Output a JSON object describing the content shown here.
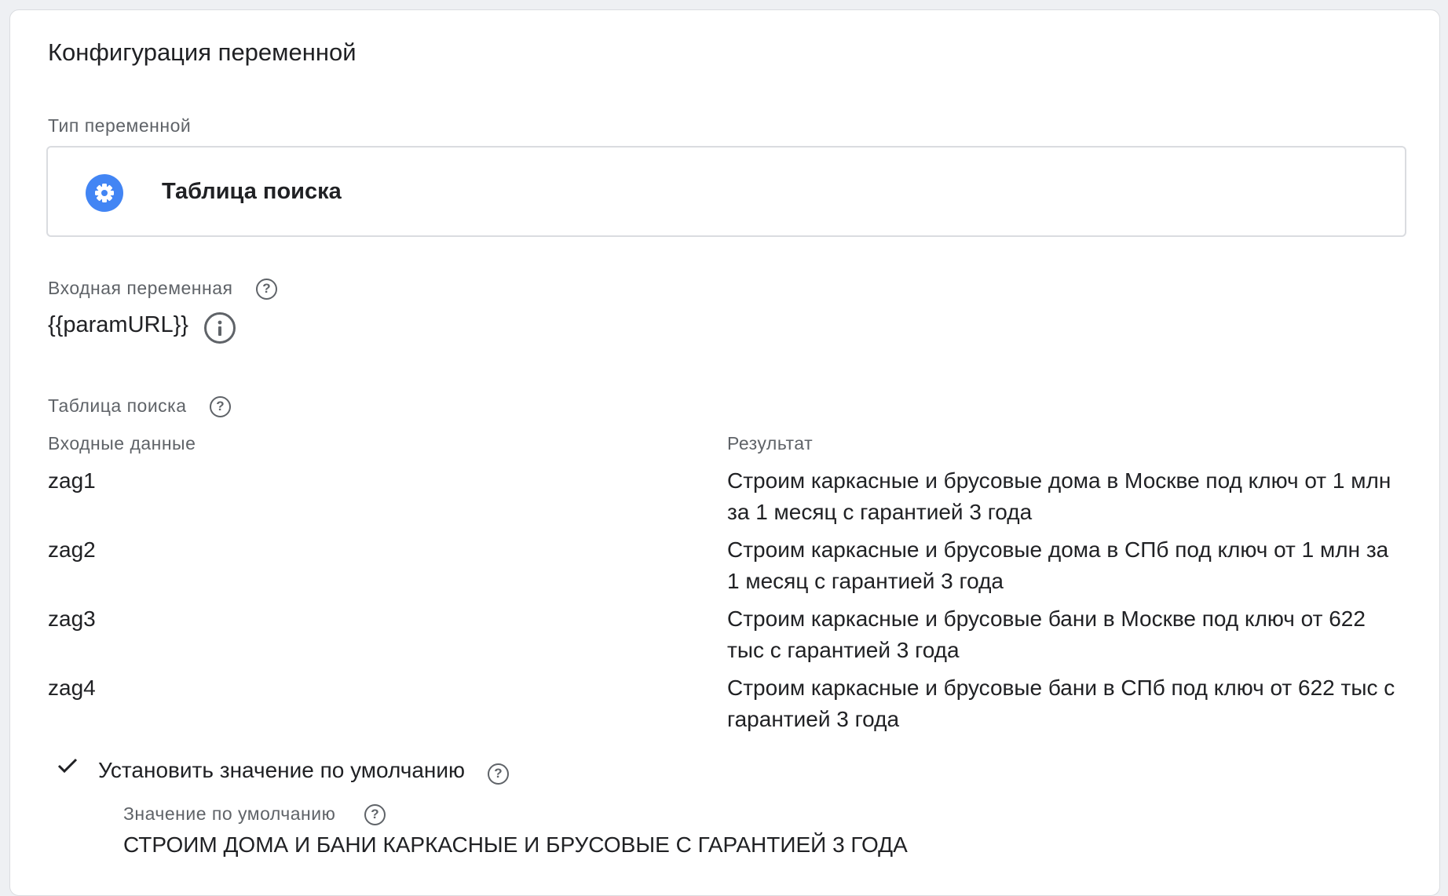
{
  "section": {
    "title": "Конфигурация переменной"
  },
  "variable_type": {
    "label": "Тип переменной",
    "value": "Таблица поиска",
    "icon": "gear-icon",
    "icon_color": "#4285f4"
  },
  "input_variable": {
    "label": "Входная переменная",
    "help_icon": "help-icon",
    "value": "{{paramURL}}",
    "info_icon": "info-icon"
  },
  "lookup_table": {
    "label": "Таблица поиска",
    "help_icon": "help-icon",
    "columns": {
      "input": "Входные данные",
      "output": "Результат"
    },
    "rows": [
      {
        "input": "zag1",
        "output": "Строим каркасные и брусовые дома в Москве под ключ от 1 млн за 1 месяц с гарантией 3 года"
      },
      {
        "input": "zag2",
        "output": "Строим каркасные и брусовые дома в СПб под ключ от 1 млн за 1 месяц с гарантией 3 года"
      },
      {
        "input": "zag3",
        "output": "Строим каркасные и брусовые бани в Москве под ключ от 622 тыс с гарантией 3 года"
      },
      {
        "input": "zag4",
        "output": "Строим каркасные и брусовые бани в СПб под ключ от 622 тыс с гарантией 3 года"
      }
    ]
  },
  "default_value": {
    "checked": true,
    "check_icon": "checkmark-icon",
    "label": "Установить значение по умолчанию",
    "sub_label": "Значение по умолчанию",
    "value": "СТРОИМ ДОМА И БАНИ КАРКАСНЫЕ И БРУСОВЫЕ С ГАРАНТИЕЙ 3 ГОДА"
  },
  "help_glyph": "?"
}
